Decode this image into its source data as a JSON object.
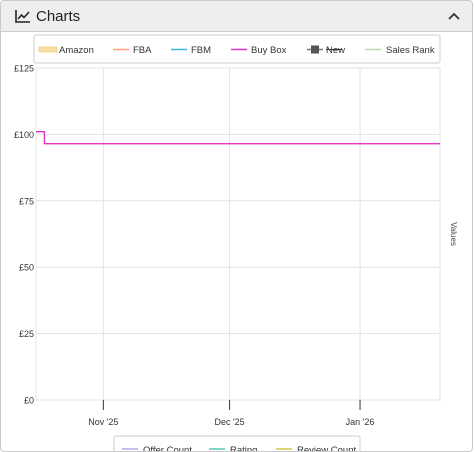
{
  "panel": {
    "title": "Charts",
    "icon": "line-chart-icon",
    "collapse_icon": "chevron-up-icon",
    "header_bg": "#eeeeee"
  },
  "legend_top": [
    {
      "label": "Amazon",
      "color": "#f7dfa5",
      "style": "band"
    },
    {
      "label": "FBA",
      "color": "#ff9c7a",
      "style": "line"
    },
    {
      "label": "FBM",
      "color": "#3fb6dc",
      "style": "line"
    },
    {
      "label": "Buy Box",
      "color": "#e632c8",
      "style": "line"
    },
    {
      "label": "New",
      "color": "#777777",
      "style": "marker",
      "hidden": true
    },
    {
      "label": "Sales Rank",
      "color": "#b9dcae",
      "style": "line"
    }
  ],
  "legend_bottom": [
    {
      "label": "Offer Count",
      "color": "#b5a6ea"
    },
    {
      "label": "Rating",
      "color": "#5cc7b2"
    },
    {
      "label": "Review Count",
      "color": "#d3c24a"
    }
  ],
  "chart_data": {
    "type": "line",
    "y_axis_label": "Values",
    "ylim": [
      0,
      125
    ],
    "y_ticks": [
      {
        "value": 0,
        "label": "£0"
      },
      {
        "value": 25,
        "label": "£25"
      },
      {
        "value": 50,
        "label": "£50"
      },
      {
        "value": 75,
        "label": "£75"
      },
      {
        "value": 100,
        "label": "£100"
      },
      {
        "value": 125,
        "label": "£125"
      }
    ],
    "x_range": [
      "2025-10-16",
      "2026-01-20"
    ],
    "x_ticks": [
      {
        "date": "2025-11-01",
        "label": "Nov '25"
      },
      {
        "date": "2025-12-01",
        "label": "Dec '25"
      },
      {
        "date": "2026-01-01",
        "label": "Jan '26"
      }
    ],
    "grid": true,
    "series": [
      {
        "name": "Buy Box",
        "color": "#e632c8",
        "step": true,
        "points": [
          {
            "x": "2025-10-16",
            "y": 101
          },
          {
            "x": "2025-10-18",
            "y": 101
          },
          {
            "x": "2025-10-18",
            "y": 96.5
          },
          {
            "x": "2026-01-20",
            "y": 96.5
          }
        ]
      }
    ]
  }
}
